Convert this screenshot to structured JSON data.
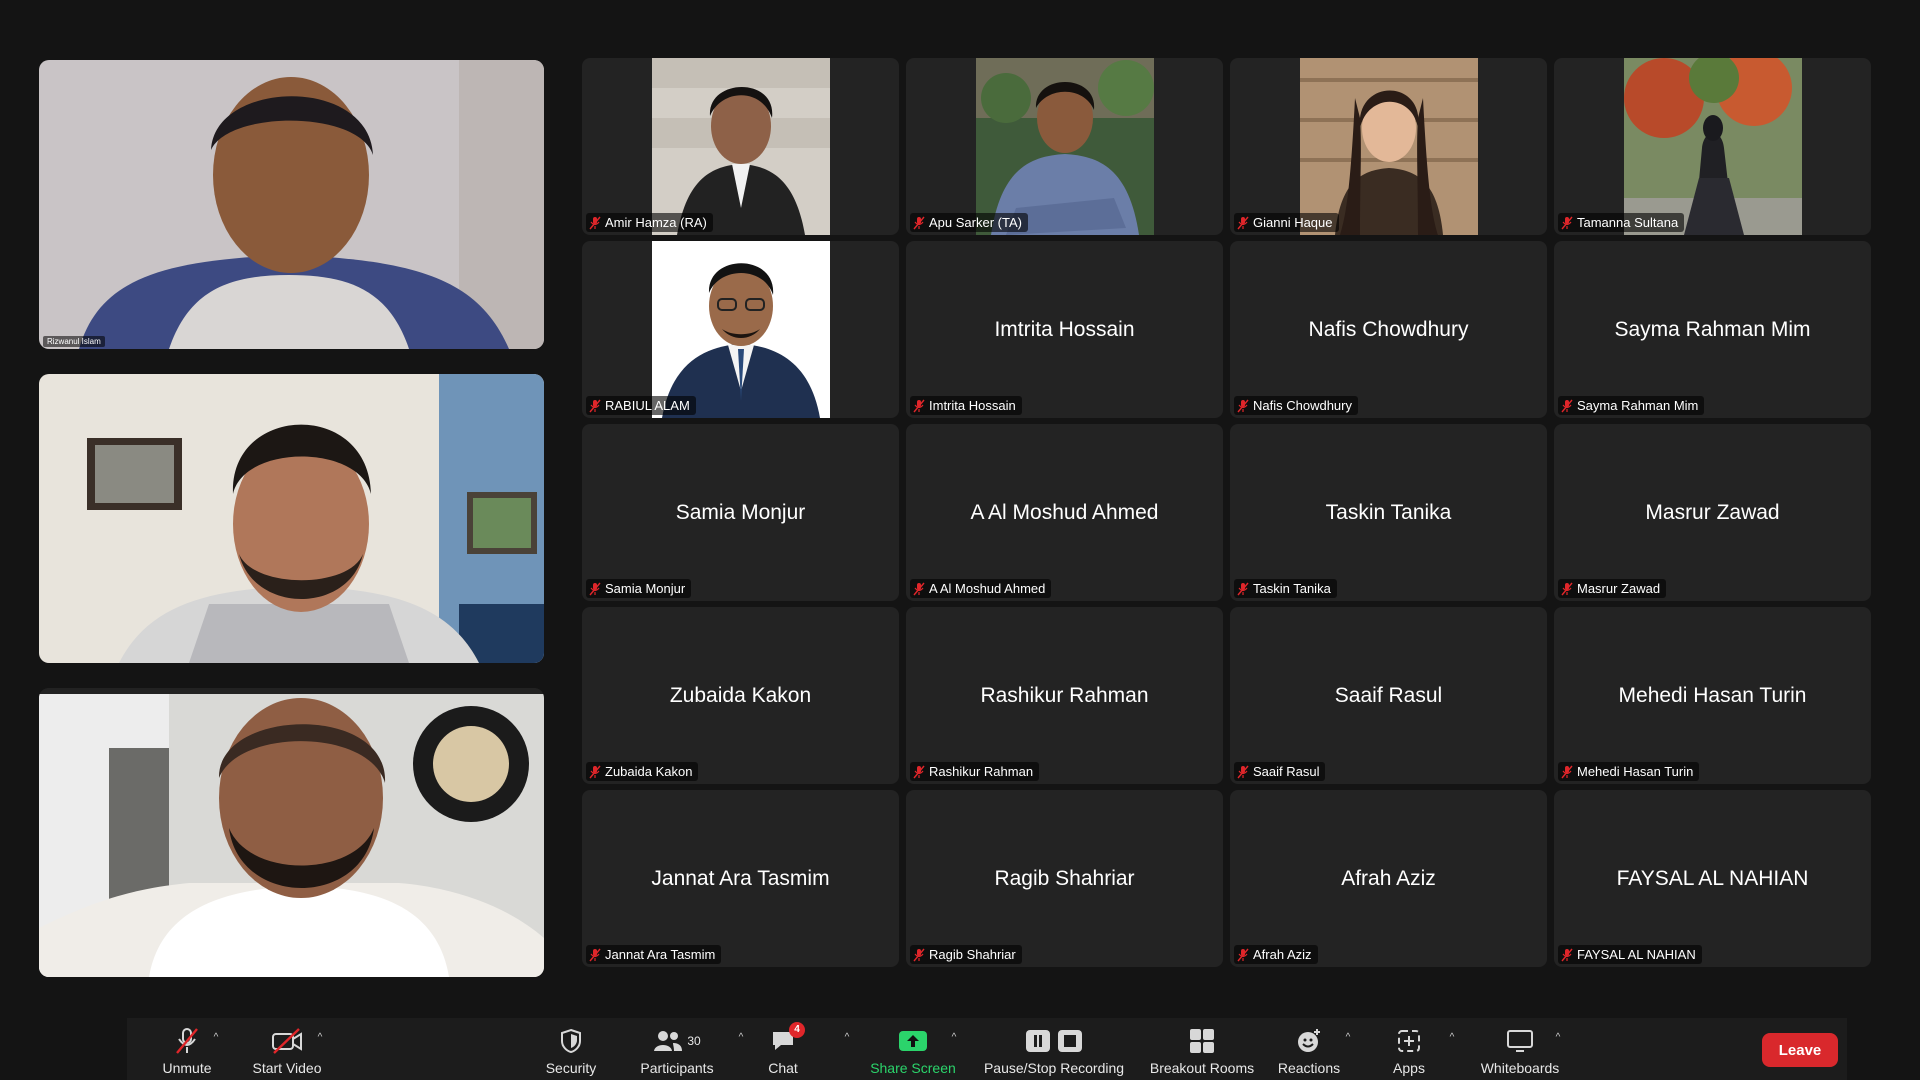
{
  "feeds": [
    {
      "name": "Rizwanul Islam"
    },
    {
      "name": ""
    },
    {
      "name": ""
    }
  ],
  "grid": {
    "tiles": [
      {
        "label": "Amir Hamza (RA)",
        "center": ""
      },
      {
        "label": "Apu Sarker (TA)",
        "center": ""
      },
      {
        "label": "Gianni Haque",
        "center": ""
      },
      {
        "label": "Tamanna Sultana",
        "center": ""
      },
      {
        "label": "RABIUL ALAM",
        "center": ""
      },
      {
        "label": "Imtrita Hossain",
        "center": "Imtrita Hossain"
      },
      {
        "label": "Nafis Chowdhury",
        "center": "Nafis Chowdhury"
      },
      {
        "label": "Sayma Rahman Mim",
        "center": "Sayma Rahman Mim"
      },
      {
        "label": "Samia Monjur",
        "center": "Samia Monjur"
      },
      {
        "label": "A Al Moshud Ahmed",
        "center": "A Al Moshud Ahmed"
      },
      {
        "label": "Taskin Tanika",
        "center": "Taskin Tanika"
      },
      {
        "label": "Masrur Zawad",
        "center": "Masrur Zawad"
      },
      {
        "label": "Zubaida Kakon",
        "center": "Zubaida Kakon"
      },
      {
        "label": "Rashikur Rahman",
        "center": "Rashikur Rahman"
      },
      {
        "label": "Saaif Rasul",
        "center": "Saaif Rasul"
      },
      {
        "label": "Mehedi Hasan Turin",
        "center": "Mehedi Hasan Turin"
      },
      {
        "label": "Jannat Ara Tasmim",
        "center": "Jannat Ara Tasmim"
      },
      {
        "label": "Ragib Shahriar",
        "center": "Ragib Shahriar"
      },
      {
        "label": "Afrah Aziz",
        "center": "Afrah Aziz"
      },
      {
        "label": "FAYSAL AL NAHIAN",
        "center": "FAYSAL AL NAHIAN"
      }
    ]
  },
  "toolbar": {
    "unmute": "Unmute",
    "start_video": "Start Video",
    "security": "Security",
    "participants": "Participants",
    "participants_count": "30",
    "chat": "Chat",
    "chat_badge": "4",
    "share_screen": "Share Screen",
    "recording": "Pause/Stop Recording",
    "breakout": "Breakout Rooms",
    "reactions": "Reactions",
    "apps": "Apps",
    "whiteboards": "Whiteboards",
    "leave": "Leave",
    "caret": "^"
  },
  "colors": {
    "background": "#141414",
    "tile": "#232323",
    "toolbar": "#1c1c1c",
    "leave": "#d9282c",
    "share_green": "#2bd46b",
    "mute_red": "#e0262a"
  }
}
